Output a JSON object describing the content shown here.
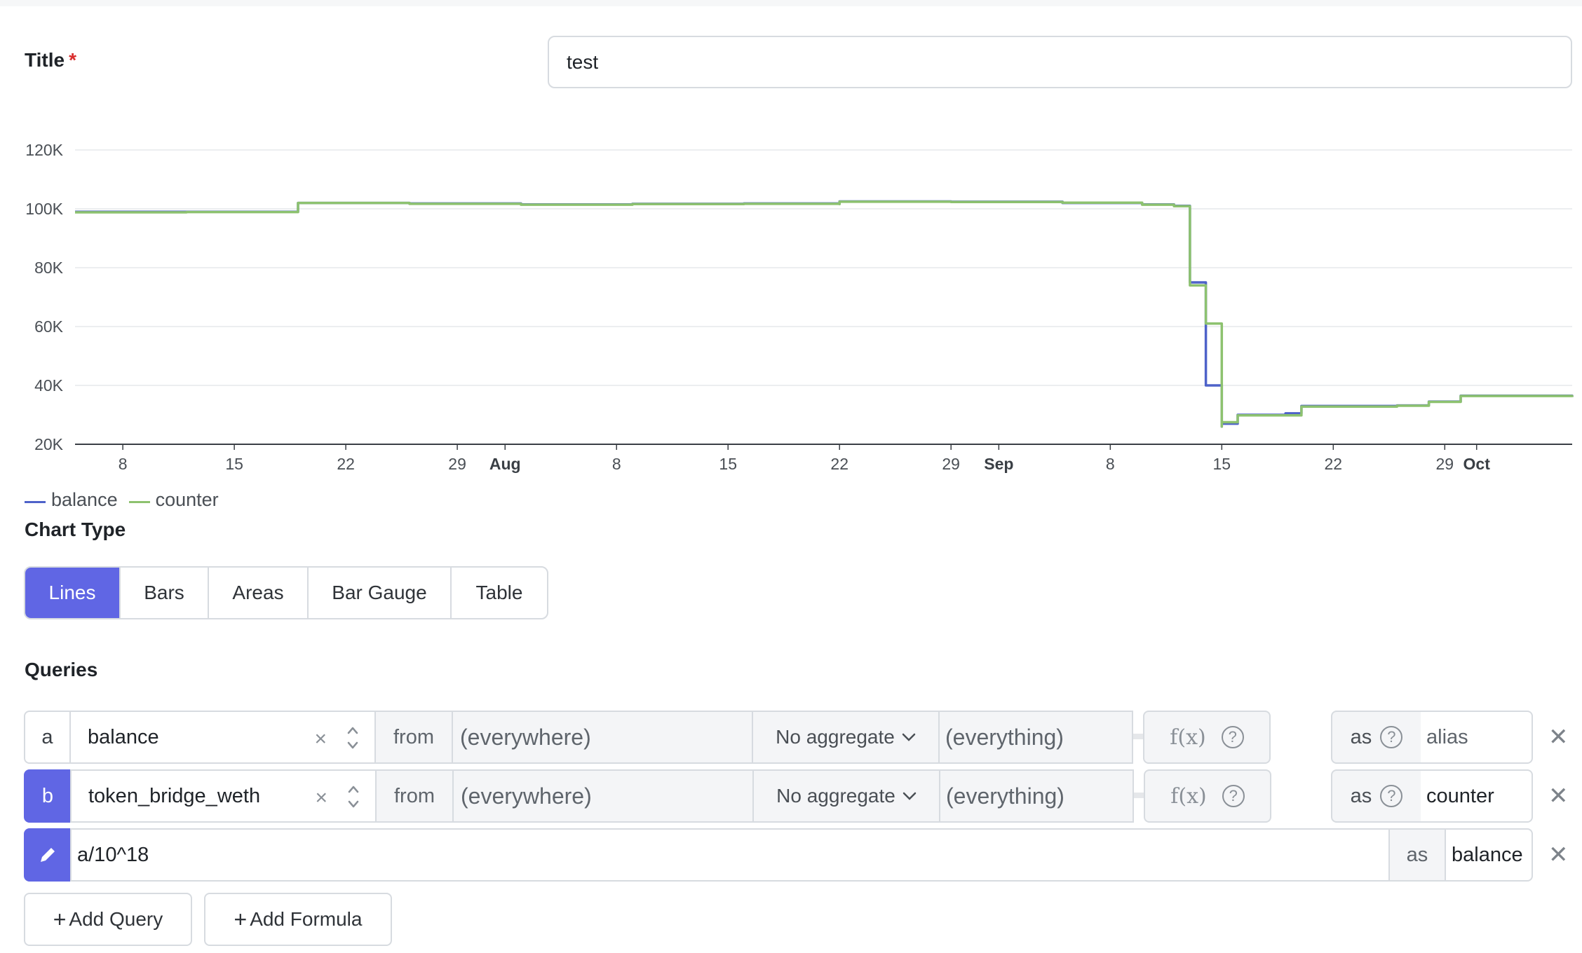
{
  "title_field": {
    "label": "Title",
    "required_mark": "*",
    "value": "test"
  },
  "chart_data": {
    "type": "line",
    "y_ticks": [
      "120K",
      "100K",
      "80K",
      "60K",
      "40K",
      "20K"
    ],
    "ylim": [
      20000,
      120000
    ],
    "x_ticks": [
      "8",
      "15",
      "22",
      "29",
      "Aug",
      "8",
      "15",
      "22",
      "29",
      "Sep",
      "8",
      "15",
      "22",
      "29",
      "Oct"
    ],
    "x_tick_bold": [
      false,
      false,
      false,
      false,
      true,
      false,
      false,
      false,
      false,
      true,
      false,
      false,
      false,
      false,
      true
    ],
    "xlim": [
      "2023-07-05",
      "2023-10-07"
    ],
    "grid": true,
    "legend_position": "bottom-left",
    "series": [
      {
        "name": "balance",
        "color": "#4e62c9",
        "points": [
          [
            "2023-07-05",
            99000
          ],
          [
            "2023-07-12",
            99000
          ],
          [
            "2023-07-19",
            99200
          ],
          [
            "2023-07-19",
            102000
          ],
          [
            "2023-07-26",
            101800
          ],
          [
            "2023-08-02",
            101500
          ],
          [
            "2023-08-09",
            101700
          ],
          [
            "2023-08-16",
            101800
          ],
          [
            "2023-08-22",
            101700
          ],
          [
            "2023-08-22",
            102500
          ],
          [
            "2023-08-29",
            102400
          ],
          [
            "2023-09-05",
            102000
          ],
          [
            "2023-09-10",
            101500
          ],
          [
            "2023-09-12",
            101000
          ],
          [
            "2023-09-13",
            90000
          ],
          [
            "2023-09-13",
            75000
          ],
          [
            "2023-09-14",
            74000
          ],
          [
            "2023-09-14",
            63000
          ],
          [
            "2023-09-14",
            60000
          ],
          [
            "2023-09-14",
            40000
          ],
          [
            "2023-09-15",
            26000
          ],
          [
            "2023-09-15",
            27000
          ],
          [
            "2023-09-16",
            30000
          ],
          [
            "2023-09-19",
            30500
          ],
          [
            "2023-09-20",
            33000
          ],
          [
            "2023-09-26",
            33200
          ],
          [
            "2023-09-28",
            34500
          ],
          [
            "2023-09-30",
            36500
          ],
          [
            "2023-10-07",
            36200
          ]
        ]
      },
      {
        "name": "counter",
        "color": "#8dc26f",
        "points": [
          [
            "2023-07-05",
            98800
          ],
          [
            "2023-07-12",
            98900
          ],
          [
            "2023-07-19",
            99100
          ],
          [
            "2023-07-19",
            102000
          ],
          [
            "2023-07-26",
            101700
          ],
          [
            "2023-08-02",
            101400
          ],
          [
            "2023-08-09",
            101600
          ],
          [
            "2023-08-16",
            101700
          ],
          [
            "2023-08-22",
            101600
          ],
          [
            "2023-08-22",
            102400
          ],
          [
            "2023-08-29",
            102300
          ],
          [
            "2023-09-05",
            102100
          ],
          [
            "2023-09-10",
            101400
          ],
          [
            "2023-09-12",
            100900
          ],
          [
            "2023-09-13",
            74000
          ],
          [
            "2023-09-14",
            73000
          ],
          [
            "2023-09-14",
            61000
          ],
          [
            "2023-09-15",
            26000
          ],
          [
            "2023-09-15",
            27500
          ],
          [
            "2023-09-16",
            29800
          ],
          [
            "2023-09-20",
            30200
          ],
          [
            "2023-09-20",
            32800
          ],
          [
            "2023-09-26",
            33100
          ],
          [
            "2023-09-28",
            34400
          ],
          [
            "2023-09-30",
            36400
          ],
          [
            "2023-10-07",
            36000
          ]
        ]
      }
    ]
  },
  "legend": {
    "items": [
      "balance",
      "counter"
    ]
  },
  "chart_type": {
    "label": "Chart Type",
    "options": [
      "Lines",
      "Bars",
      "Areas",
      "Bar Gauge",
      "Table"
    ],
    "selected": "Lines"
  },
  "queries": {
    "label": "Queries",
    "rows": [
      {
        "letter": "a",
        "metric": "balance",
        "from_label": "from",
        "where": "(everywhere)",
        "aggregate": "No aggregate",
        "group": "(everything)",
        "fx": "f(x)",
        "as_label": "as",
        "alias_placeholder": "alias",
        "alias": ""
      },
      {
        "letter": "b",
        "metric": "token_bridge_weth",
        "from_label": "from",
        "where": "(everywhere)",
        "aggregate": "No aggregate",
        "group": "(everything)",
        "fx": "f(x)",
        "as_label": "as",
        "alias_placeholder": "",
        "alias": "counter"
      }
    ],
    "formula": {
      "expression": "a/10^18",
      "as_label": "as",
      "alias": "balance"
    }
  },
  "actions": {
    "add_query": "Add Query",
    "add_formula": "Add Formula"
  },
  "colors": {
    "accent": "#6066e4",
    "balance_line": "#4e62c9",
    "counter_line": "#8dc26f"
  }
}
